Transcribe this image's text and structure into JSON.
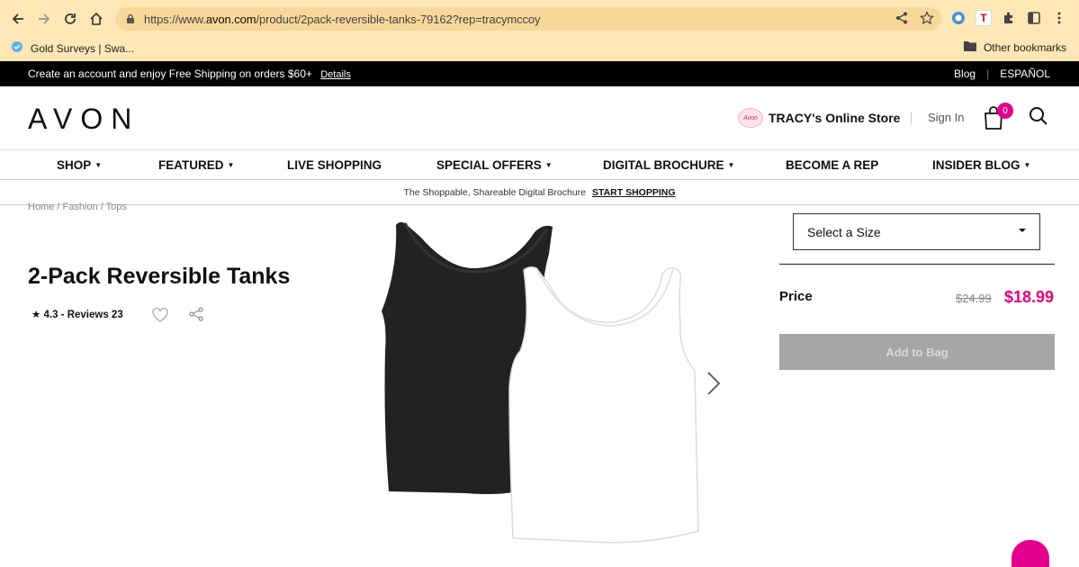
{
  "browser": {
    "url_prefix": "https://www.",
    "url_domain": "avon.com",
    "url_path": "/product/2pack-reversible-tanks-79162?rep=tracymccoy",
    "bookmark_left": "Gold Surveys | Swa...",
    "bookmark_right": "Other bookmarks",
    "ext_t_label": "T"
  },
  "promo": {
    "text": "Create an account and enjoy Free Shipping on orders $60+",
    "link": "Details",
    "blog": "Blog",
    "sep": "|",
    "language": "ESPAÑOL"
  },
  "header": {
    "logo": "AVON",
    "store_name": "TRACY's Online Store",
    "store_badge_text": "Avon",
    "sign_in": "Sign In",
    "bag_count": "0"
  },
  "nav": {
    "items": [
      {
        "label": "SHOP",
        "caret": "▼"
      },
      {
        "label": "FEATURED",
        "caret": "▼"
      },
      {
        "label": "LIVE SHOPPING",
        "caret": ""
      },
      {
        "label": "SPECIAL OFFERS",
        "caret": "▼"
      },
      {
        "label": "DIGITAL BROCHURE",
        "caret": "▼"
      },
      {
        "label": "BECOME A REP",
        "caret": ""
      },
      {
        "label": "INSIDER BLOG",
        "caret": "▼"
      }
    ]
  },
  "subbar": {
    "text": "The Shoppable, Shareable Digital Brochure",
    "cta": "START SHOPPING"
  },
  "product": {
    "breadcrumb": "Home / Fashion / Tops",
    "title": "2-Pack Reversible Tanks",
    "rating": "★ 4.3 - Reviews 23",
    "size_placeholder": "Select a Size",
    "price_label": "Price",
    "price_old": "$24.99",
    "price_new": "$18.99",
    "add_to_bag": "Add to Bag"
  },
  "colors": {
    "accent": "#e5007d",
    "chrome_bg": "#fde7b6",
    "promo_bg": "#000000",
    "button_disabled": "#a6a6a6"
  }
}
